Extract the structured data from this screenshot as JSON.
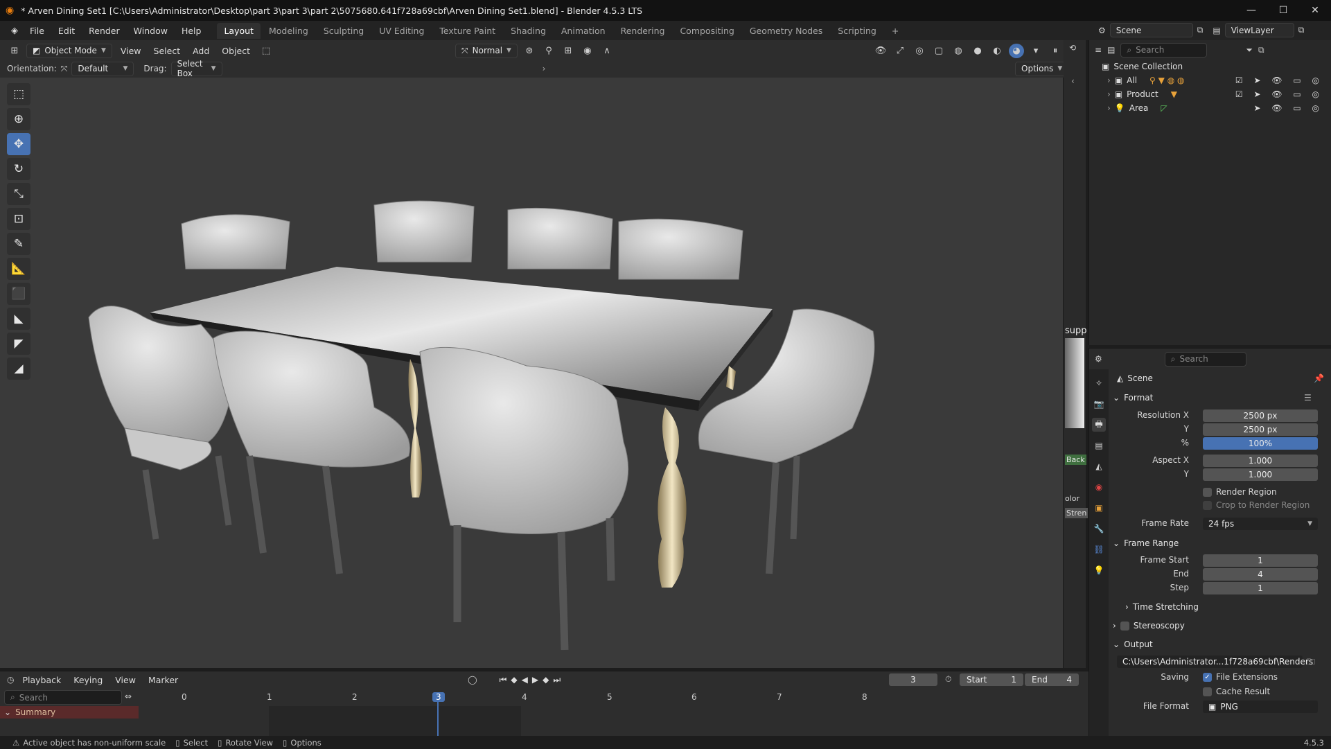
{
  "window": {
    "title": "* Arven Dining Set1 [C:\\Users\\Administrator\\Desktop\\part 3\\part 3\\part 2\\5075680.641f728a69cbf\\Arven Dining Set1.blend] - Blender 4.5.3 LTS",
    "minimize": "—",
    "maximize": "☐",
    "close": "✕"
  },
  "menu": [
    "File",
    "Edit",
    "Render",
    "Window",
    "Help"
  ],
  "workspaces": [
    "Layout",
    "Modeling",
    "Sculpting",
    "UV Editing",
    "Texture Paint",
    "Shading",
    "Animation",
    "Rendering",
    "Compositing",
    "Geometry Nodes",
    "Scripting"
  ],
  "workspace_add": "+",
  "scene_selector": {
    "label": "Scene",
    "viewlayer": "ViewLayer"
  },
  "viewport": {
    "mode": "Object Mode",
    "menus": [
      "View",
      "Select",
      "Add",
      "Object"
    ],
    "transform_orientation": "Normal",
    "orientation_label": "Orientation:",
    "orientation_value": "Default",
    "drag_label": "Drag:",
    "drag_value": "Select Box",
    "options": "Options",
    "side_label_1": "supp",
    "side_label_2": "Back",
    "side_label_3": "olor",
    "side_label_4": "Stren"
  },
  "outliner": {
    "search_placeholder": "Search",
    "root": "Scene Collection",
    "items": [
      {
        "label": "All"
      },
      {
        "label": "Product"
      },
      {
        "label": "Area"
      }
    ]
  },
  "properties": {
    "search_placeholder": "Search",
    "context": "Scene",
    "format": {
      "header": "Format",
      "resolution_x_label": "Resolution X",
      "resolution_x": "2500 px",
      "resolution_y_label": "Y",
      "resolution_y": "2500 px",
      "percent_label": "%",
      "percent": "100%",
      "aspect_x_label": "Aspect X",
      "aspect_x": "1.000",
      "aspect_y_label": "Y",
      "aspect_y": "1.000",
      "render_region": "Render Region",
      "crop_region": "Crop to Render Region",
      "frame_rate_label": "Frame Rate",
      "frame_rate": "24 fps"
    },
    "frame_range": {
      "header": "Frame Range",
      "start_label": "Frame Start",
      "start": "1",
      "end_label": "End",
      "end": "4",
      "step_label": "Step",
      "step": "1",
      "time_stretching": "Time Stretching"
    },
    "stereoscopy": "Stereoscopy",
    "output": {
      "header": "Output",
      "path": "C:\\Users\\Administrator...1f728a69cbf\\Renders",
      "saving_label": "Saving",
      "file_extensions": "File Extensions",
      "cache_result": "Cache Result",
      "file_format_label": "File Format",
      "file_format": "PNG"
    }
  },
  "timeline": {
    "menus": [
      "Playback",
      "Keying",
      "View",
      "Marker"
    ],
    "current_frame": "3",
    "start_label": "Start",
    "start": "1",
    "end_label": "End",
    "end": "4",
    "search_placeholder": "Search",
    "summary": "Summary",
    "ticks": [
      "0",
      "1",
      "2",
      "3",
      "4",
      "5",
      "6",
      "7",
      "8"
    ]
  },
  "statusbar": {
    "warning": "Active object has non-uniform scale",
    "select": "Select",
    "rotate": "Rotate View",
    "options": "Options",
    "version": "4.5.3"
  },
  "colors": {
    "accent": "#4772b3",
    "viewport_bg": "#3a3a3a",
    "panel_bg": "#2b2b2b"
  }
}
